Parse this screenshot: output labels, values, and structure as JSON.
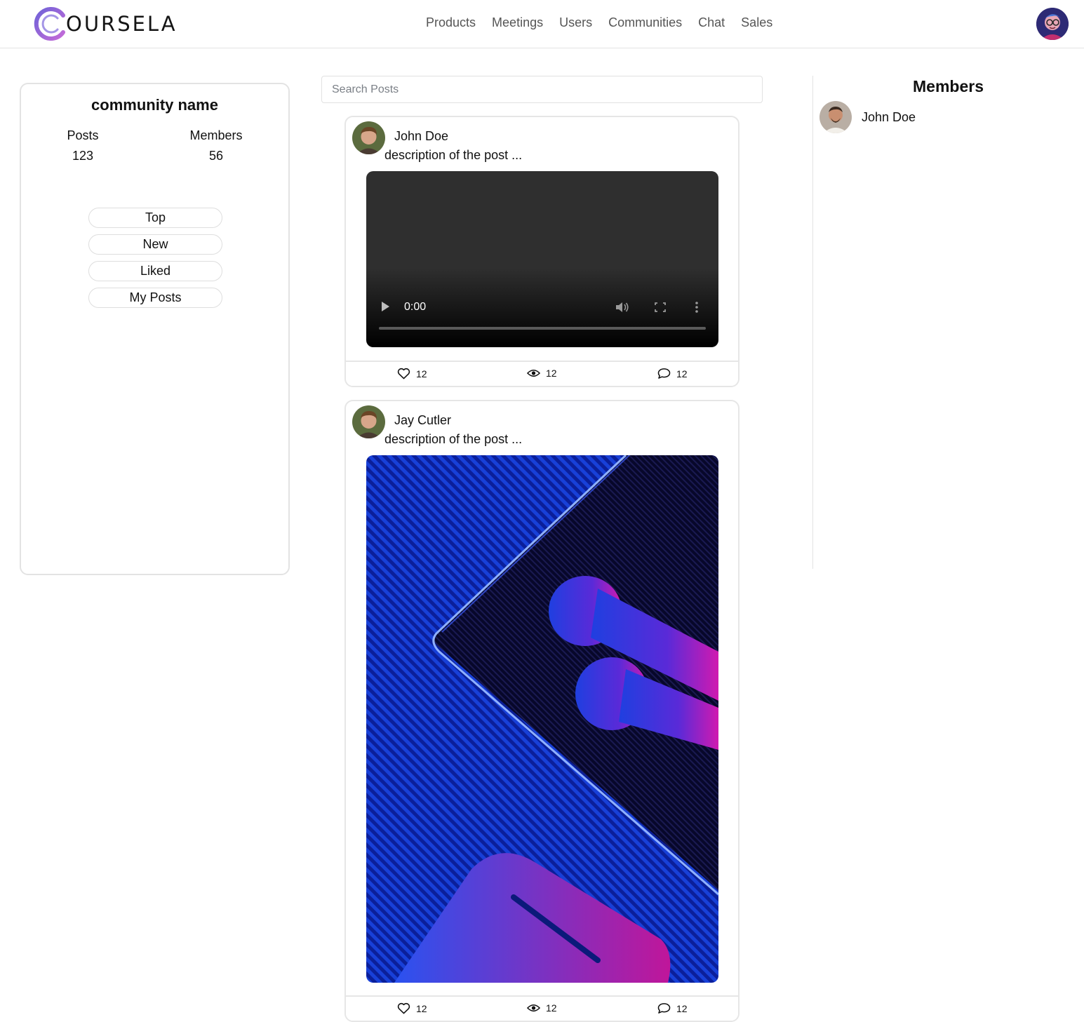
{
  "header": {
    "logo_text": "OURSELA",
    "nav": [
      "Products",
      "Meetings",
      "Users",
      "Communities",
      "Chat",
      "Sales"
    ]
  },
  "community": {
    "name": "community name",
    "posts_label": "Posts",
    "posts_value": "123",
    "members_label": "Members",
    "members_value": "56",
    "filters": [
      "Top",
      "New",
      "Liked",
      "My Posts"
    ]
  },
  "search": {
    "placeholder": "Search Posts",
    "value": ""
  },
  "posts": [
    {
      "author": "John Doe",
      "description": "description of the post ...",
      "media": "video",
      "video_time": "0:00",
      "likes": "12",
      "views": "12",
      "comments": "12"
    },
    {
      "author": "Jay Cutler",
      "description": "description of the post ...",
      "media": "image",
      "likes": "12",
      "views": "12",
      "comments": "12"
    }
  ],
  "members_panel": {
    "title": "Members",
    "members": [
      {
        "name": "John Doe"
      }
    ]
  },
  "icons": {
    "logo": "logo-c-icon",
    "like": "heart-icon",
    "view": "eye-icon",
    "comment": "comment-icon",
    "play": "play-icon",
    "volume": "volume-icon",
    "fullscreen": "fullscreen-icon",
    "more": "more-vertical-icon"
  },
  "colors": {
    "brand_gradient_start": "#7b5cd6",
    "brand_gradient_end": "#c06ad9",
    "border": "#e3e3e3",
    "nav_text": "#555555"
  }
}
